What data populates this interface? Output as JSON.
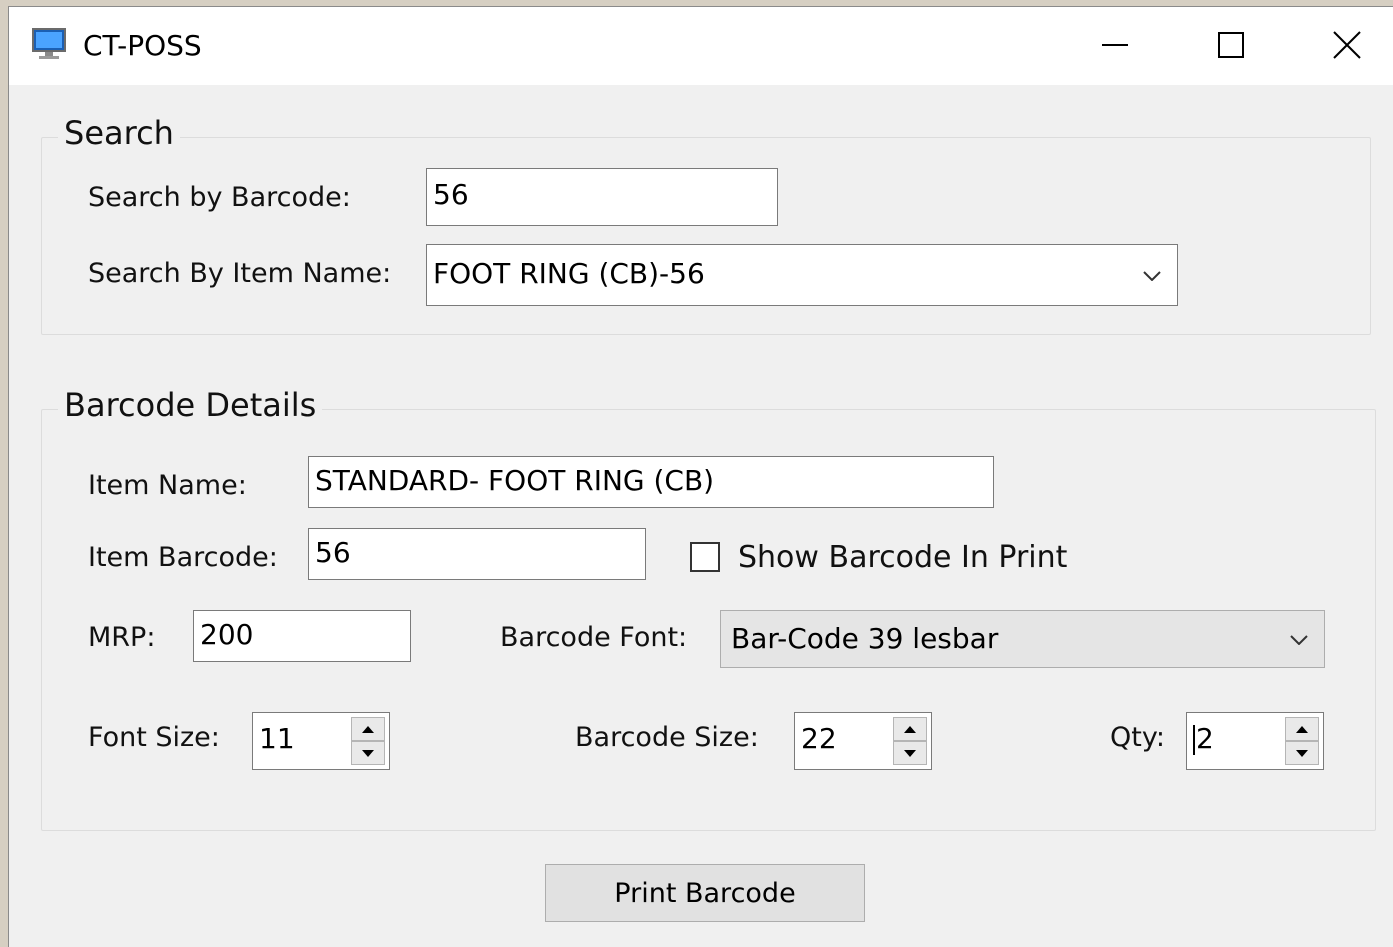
{
  "window": {
    "title": "CT-POSS"
  },
  "search": {
    "legend": "Search",
    "barcode_label": "Search by Barcode:",
    "barcode_value": "56",
    "item_name_label": "Search By Item Name:",
    "item_name_value": "FOOT RING (CB)-56"
  },
  "details": {
    "legend": "Barcode Details",
    "item_name_label": "Item Name:",
    "item_name_value": "STANDARD- FOOT RING (CB)",
    "item_barcode_label": "Item Barcode:",
    "item_barcode_value": "56",
    "show_barcode_label": "Show Barcode In Print",
    "show_barcode_checked": false,
    "mrp_label": "MRP:",
    "mrp_value": "200",
    "barcode_font_label": "Barcode Font:",
    "barcode_font_value": "Bar-Code 39 lesbar",
    "font_size_label": "Font Size:",
    "font_size_value": "11",
    "barcode_size_label": "Barcode Size:",
    "barcode_size_value": "22",
    "qty_label": "Qty:",
    "qty_value": "2"
  },
  "actions": {
    "print_label": "Print Barcode"
  },
  "icons": {
    "app": "monitor-icon",
    "minimize": "minimize-icon",
    "maximize": "maximize-icon",
    "close": "close-icon"
  }
}
